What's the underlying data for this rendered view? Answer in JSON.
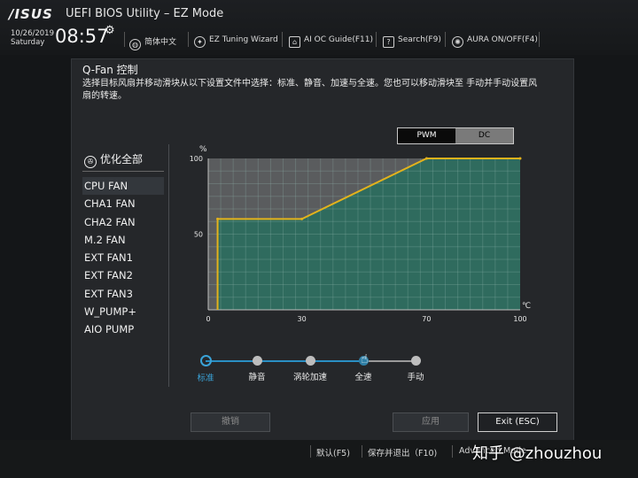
{
  "header": {
    "logo": "/ISUS",
    "title": "UEFI BIOS Utility – EZ Mode",
    "date": "10/26/2019",
    "weekday": "Saturday",
    "time": "08:57",
    "toolbar": [
      {
        "label": "简体中文",
        "icon": "globe-icon"
      },
      {
        "label": "EZ Tuning Wizard",
        "icon": "wizard-icon"
      },
      {
        "label": "AI OC Guide(F11)",
        "icon": "ai-icon"
      },
      {
        "label": "Search(F9)",
        "icon": "search-icon"
      },
      {
        "label": "AURA ON/OFF(F4)",
        "icon": "aura-icon"
      }
    ]
  },
  "dialog": {
    "title": "Q-Fan 控制",
    "description": "选择目标风扇并移动滑块从以下设置文件中选择：标准、静音、加速与全速。您也可以移动滑块至 手动并手动设置风扇的转速。",
    "mode": {
      "pwm": "PWM",
      "dc": "DC",
      "selected": "PWM"
    },
    "fan_header": "优化全部",
    "fans": [
      "CPU FAN",
      "CHA1 FAN",
      "CHA2 FAN",
      "M.2 FAN",
      "EXT FAN1",
      "EXT FAN2",
      "EXT FAN3",
      "W_PUMP+",
      "AIO PUMP"
    ],
    "selected_fan": "CPU FAN",
    "presets": [
      "标准",
      "静音",
      "涡轮加速",
      "全速",
      "手动"
    ],
    "selected_preset": "标准",
    "buttons": {
      "undo": "撤销",
      "apply": "应用",
      "exit": "Exit (ESC)"
    }
  },
  "chart_data": {
    "type": "line",
    "xlabel": "℃",
    "ylabel": "%",
    "xlim": [
      0,
      100
    ],
    "ylim": [
      0,
      100
    ],
    "x_ticks": [
      "0",
      "30",
      "70",
      "100"
    ],
    "y_ticks": [
      "50",
      "100"
    ],
    "grid": true,
    "series": [
      {
        "x": [
          3,
          3,
          30,
          70,
          100
        ],
        "y": [
          0,
          60,
          60,
          100,
          100
        ]
      }
    ],
    "colors": {
      "line": "#e3b21c",
      "fill": "#2f6b5e",
      "fill_upper": "#5a5c5e"
    }
  },
  "footer": {
    "items": [
      "默认(F5)",
      "保存并退出（F10)",
      "Advanced Mode"
    ],
    "watermark": "知乎 @zhouzhou"
  }
}
